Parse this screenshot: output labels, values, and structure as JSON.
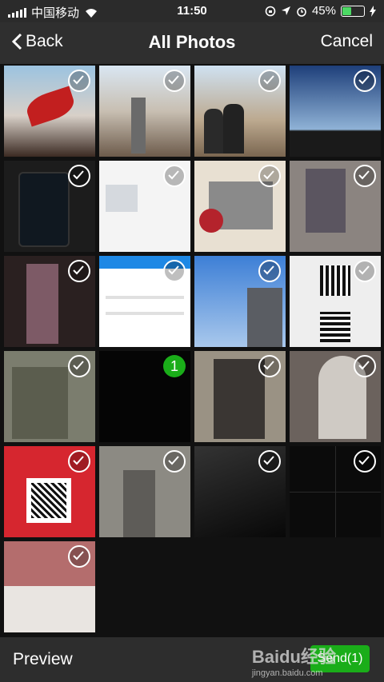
{
  "status": {
    "carrier": "中国移动",
    "time": "11:50",
    "battery": "45%",
    "battery_level": 0.45
  },
  "nav": {
    "back": "Back",
    "title": "All Photos",
    "cancel": "Cancel"
  },
  "selected_number": "1",
  "bottom": {
    "preview": "Preview",
    "send": "Send(1)"
  },
  "watermark": {
    "text": "Baidu经验",
    "sub": "jingyan.baidu.com"
  }
}
